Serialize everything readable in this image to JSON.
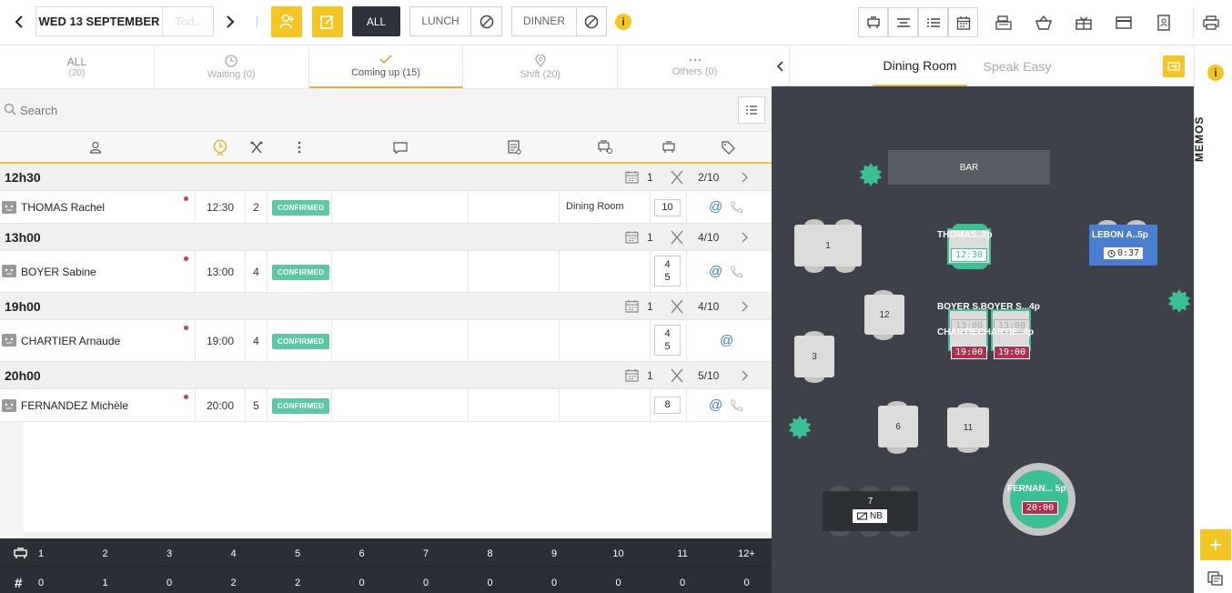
{
  "topbar": {
    "date": "WED 13 SEPTEMBER",
    "today": "Tod..",
    "service_all": "ALL",
    "service_lunch": "LUNCH",
    "service_dinner": "DINNER"
  },
  "tabs": [
    {
      "label": "ALL",
      "count": "(20)"
    },
    {
      "label": "Waiting (0)"
    },
    {
      "label": "Coming up (15)"
    },
    {
      "label": "Shift (20)"
    },
    {
      "label": "Others (0)"
    }
  ],
  "search": {
    "placeholder": "Search"
  },
  "groups": [
    {
      "time": "12h30",
      "count": "1",
      "ratio": "2/10"
    },
    {
      "time": "13h00",
      "count": "1",
      "ratio": "4/10"
    },
    {
      "time": "19h00",
      "count": "1",
      "ratio": "4/10"
    },
    {
      "time": "20h00",
      "count": "1",
      "ratio": "5/10"
    }
  ],
  "rows": [
    {
      "name": "THOMAS Rachel",
      "time": "12:30",
      "covers": "2",
      "status": "CONFIRMED",
      "room": "Dining Room",
      "tables": "10"
    },
    {
      "name": "BOYER Sabine",
      "time": "13:00",
      "covers": "4",
      "status": "CONFIRMED",
      "room": "",
      "tables": "4\n5"
    },
    {
      "name": "CHARTIER Arnaude",
      "time": "19:00",
      "covers": "4",
      "status": "CONFIRMED",
      "room": "",
      "tables": "4\n5"
    },
    {
      "name": "FERNANDEZ Michèle",
      "time": "20:00",
      "covers": "5",
      "status": "CONFIRMED",
      "room": "",
      "tables": "8"
    }
  ],
  "footer": {
    "sizes": [
      "1",
      "2",
      "3",
      "4",
      "5",
      "6",
      "7",
      "8",
      "9",
      "10",
      "11",
      "12+"
    ],
    "counts": [
      "0",
      "1",
      "0",
      "2",
      "2",
      "0",
      "0",
      "0",
      "0",
      "0",
      "0",
      "0"
    ]
  },
  "floor": {
    "tab_dining": "Dining Room",
    "tab_speakeasy": "Speak Easy",
    "bar": "BAR",
    "tables": [
      "1",
      "12",
      "3",
      "6",
      "11",
      "7"
    ],
    "nb": "NB",
    "labels": {
      "thomas": "THOMAS..2p",
      "thomas_time": "12:30",
      "lebon": "LEBON A..5p",
      "lebon_time": "0:37",
      "boyer": "BOYER S.BOYER S...4p",
      "boyer_t1": "13:00",
      "boyer_t2": "13:00",
      "chartier": "CHARTIECHARTIE..4p",
      "chartier_t1": "19:00",
      "chartier_t2": "19:00",
      "fernandez": "FERNAN... 5p",
      "fernandez_time": "20:00"
    }
  },
  "memos": {
    "label": "MEMOS"
  },
  "colors": {
    "accent": "#f3c623",
    "confirmed": "#5cc8a4",
    "floor_bg": "#3e4149",
    "late": "#b03050",
    "selected": "#4a7fd0"
  }
}
